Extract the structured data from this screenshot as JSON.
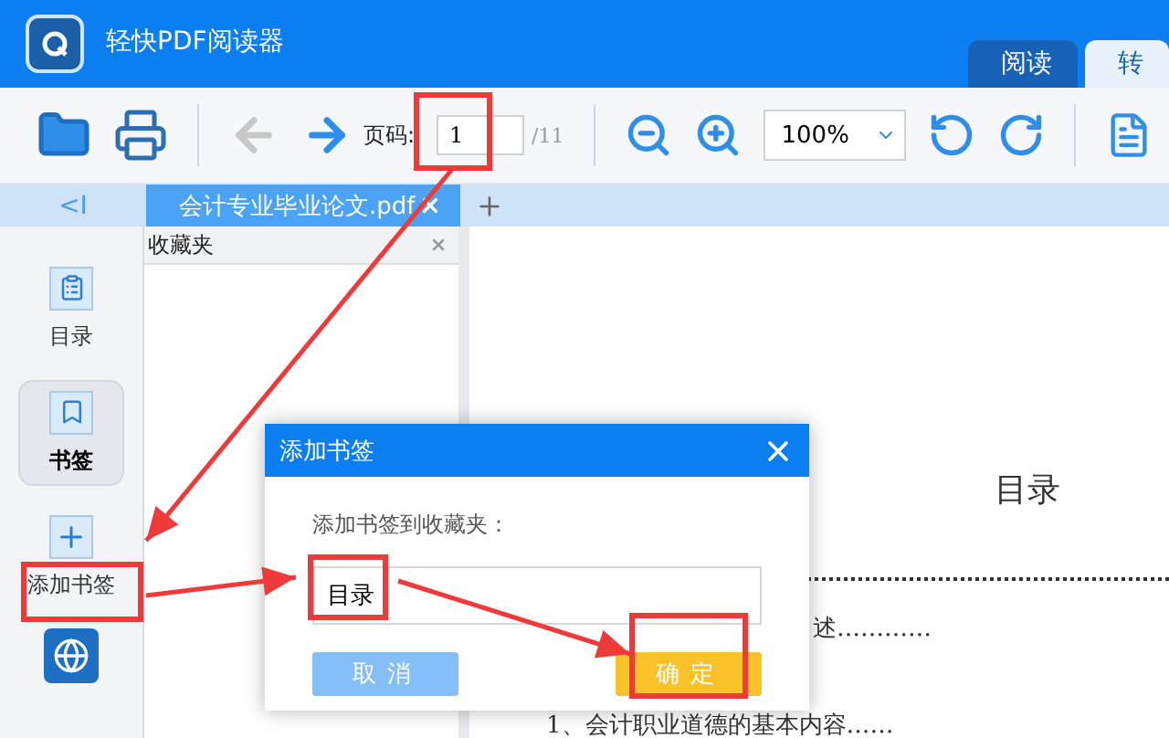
{
  "app": {
    "title": "轻快PDF阅读器"
  },
  "mode_tabs": [
    {
      "label": "阅读",
      "selected": true
    },
    {
      "label": "转",
      "selected": false
    }
  ],
  "toolbar": {
    "nav": [
      {
        "kind": "back",
        "disabled": true
      },
      {
        "kind": "forward",
        "disabled": false
      }
    ],
    "page_label": "页码:",
    "page_value": "1",
    "page_total": "/11",
    "zoom": "100%"
  },
  "collapse": "<I",
  "doc_tabs": [
    {
      "label": "会计专业毕业论文.pdf",
      "selected": true
    }
  ],
  "sidebar": {
    "items": [
      {
        "kind": "toc",
        "label": "目录",
        "selected": false
      },
      {
        "kind": "bookmark",
        "label": "书签",
        "selected": true
      },
      {
        "kind": "add",
        "label": "添加书签",
        "selected": false
      },
      {
        "kind": "app"
      }
    ]
  },
  "panel": {
    "title": "收藏夹"
  },
  "document": {
    "heading": "目录",
    "lines": [
      "述…………",
      "1、会计职业道德的基本内容……"
    ]
  },
  "dialog": {
    "title": "添加书签",
    "prompt": "添加书签到收藏夹：",
    "value": "目录",
    "buttons": [
      {
        "kind": "cancel",
        "label": "取消"
      },
      {
        "kind": "confirm",
        "label": "确定"
      }
    ]
  }
}
